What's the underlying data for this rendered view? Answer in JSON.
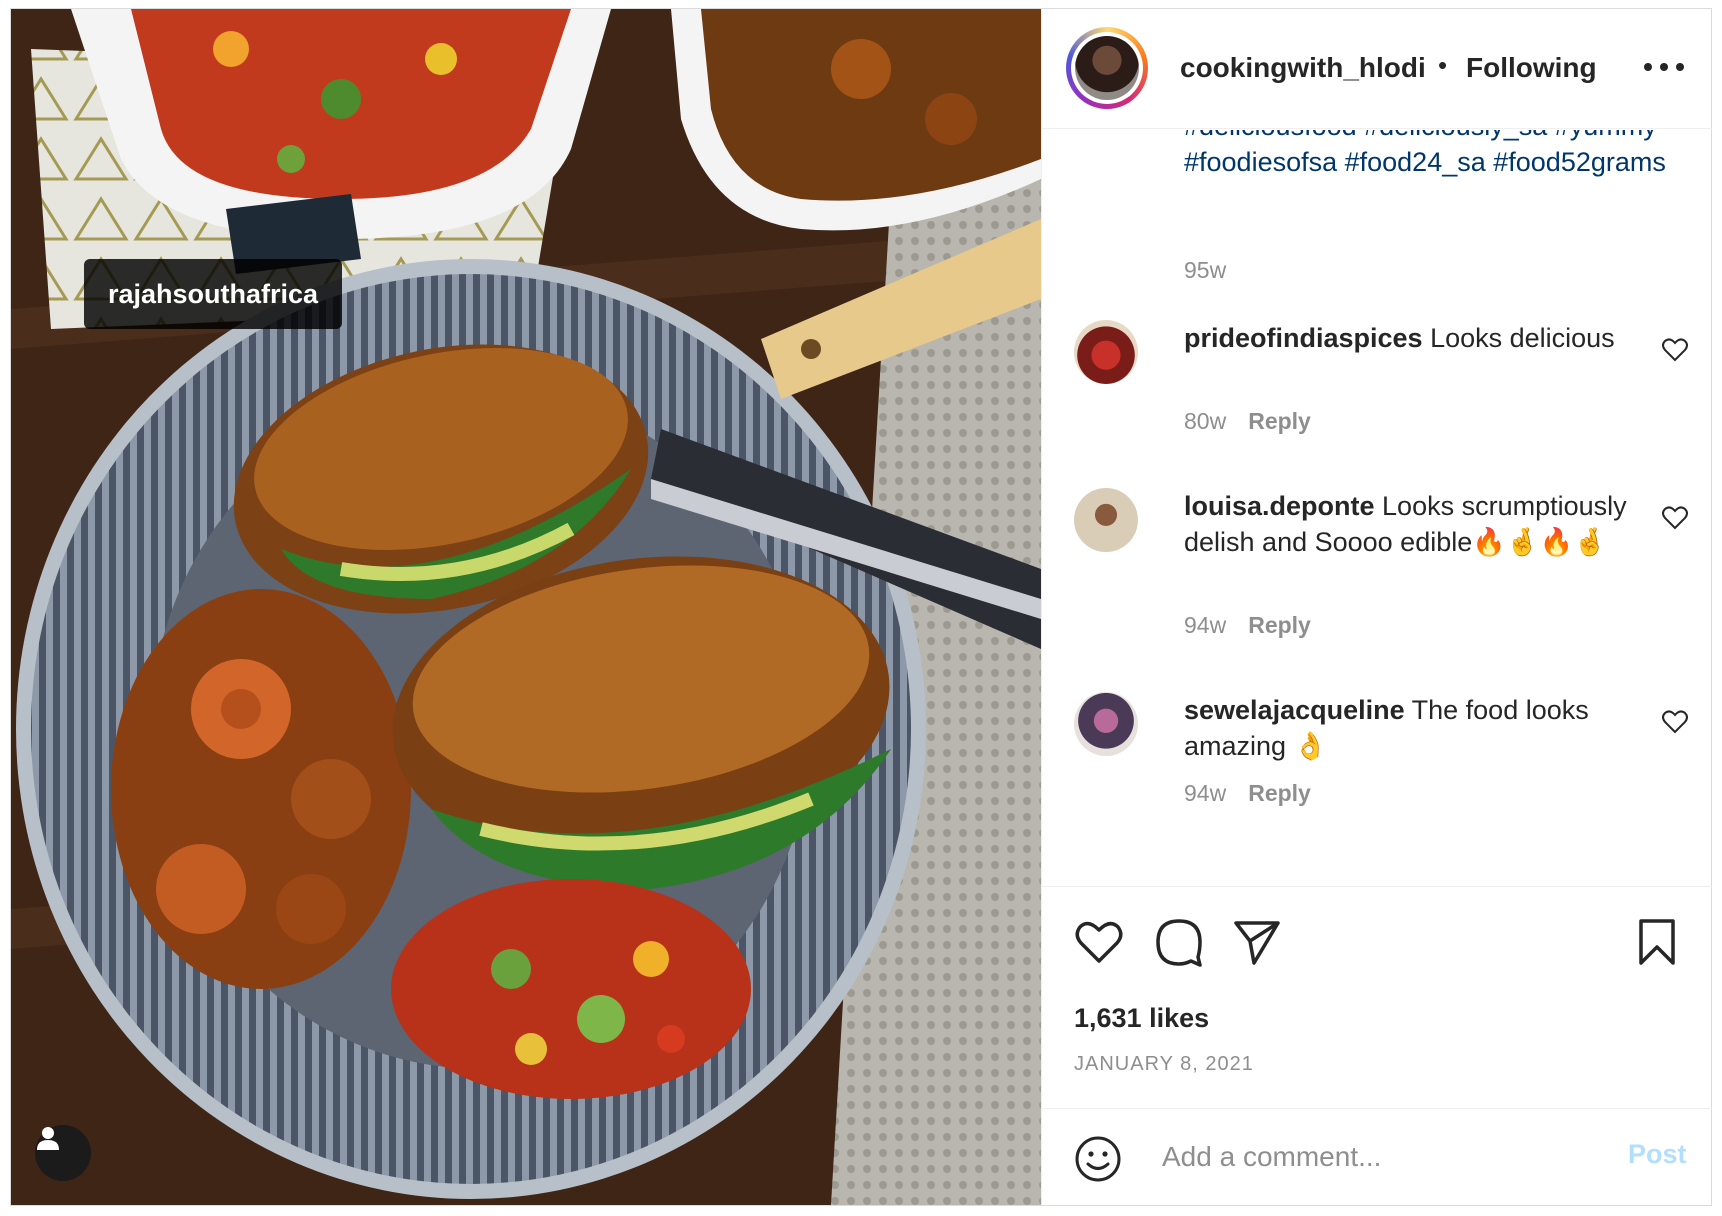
{
  "media": {
    "user_tag": "rajahsouthafrica",
    "user_tag_icon": "person-icon"
  },
  "header": {
    "username": "cookingwith_hlodi",
    "separator": "•",
    "follow_status": "Following",
    "more_icon": "more-horizontal-icon"
  },
  "caption": {
    "hashtags": "#deliciousfood #deliciously_sa #yummy #foodiesofsa #food24_sa #food52grams",
    "time": "95w"
  },
  "comments": [
    {
      "username": "prideofindiaspices",
      "text": " Looks delicious",
      "time": "80w",
      "reply": "Reply"
    },
    {
      "username": "louisa.deponte",
      "text": " Looks scrumptiously delish and Soooo edible🔥🤞🔥🤞",
      "time": "94w",
      "reply": "Reply"
    },
    {
      "username": "sewelajacqueline",
      "text": " The food looks amazing 👌",
      "time": "94w",
      "reply": "Reply"
    }
  ],
  "actions": {
    "like_icon": "heart-icon",
    "comment_icon": "comment-bubble-icon",
    "share_icon": "paper-plane-icon",
    "save_icon": "bookmark-icon",
    "likes": "1,631 likes",
    "date": "JANUARY 8, 2021"
  },
  "add_comment": {
    "placeholder": "Add a comment...",
    "post_label": "Post",
    "emoji_icon": "smiley-icon"
  },
  "colors": {
    "link_blue": "#00376b",
    "post_disabled": "#b2dffc",
    "muted_text": "#8e8e8e",
    "border": "#dbdbdb"
  }
}
